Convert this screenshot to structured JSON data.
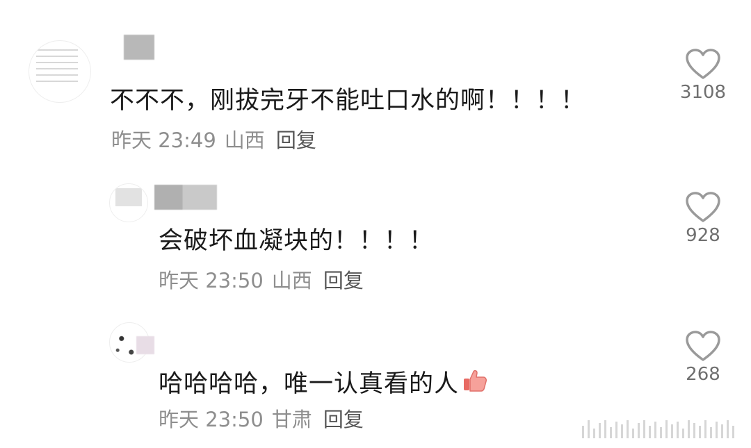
{
  "comments": [
    {
      "text": "不不不，刚拔完牙不能吐口水的啊！！！！",
      "time": "昨天 23:49",
      "location": "山西",
      "reply_label": "回复",
      "likes": "3108"
    },
    {
      "text": "会破坏血凝块的！！！！",
      "time": "昨天 23:50",
      "location": "山西",
      "reply_label": "回复",
      "likes": "928"
    },
    {
      "text": "哈哈哈哈，唯一认真看的人",
      "time": "昨天 23:50",
      "location": "甘肃",
      "reply_label": "回复",
      "likes": "268",
      "emoji": "thumbs-up-icon"
    }
  ],
  "colors": {
    "text": "#1a1a1a",
    "meta": "#8e8e8e",
    "heart_outline": "#9a9a9a",
    "thumb": "#f28b82"
  }
}
